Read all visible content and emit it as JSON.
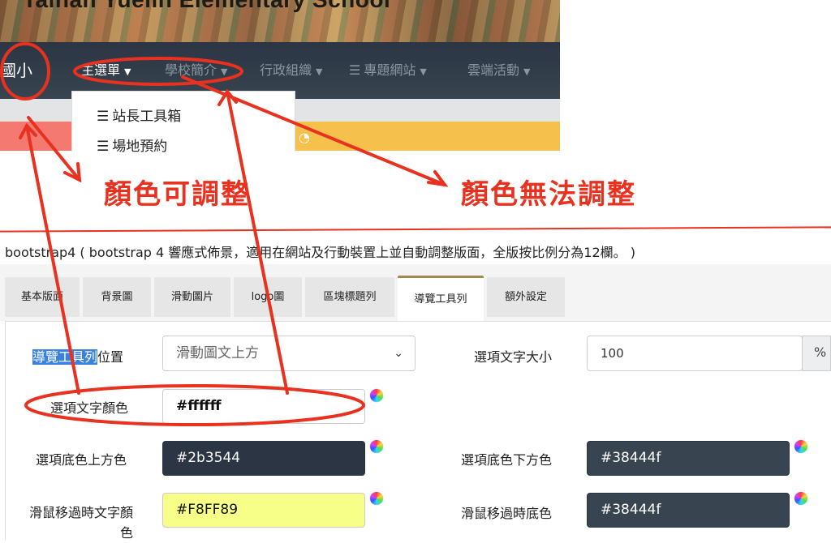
{
  "banner": {
    "title": "Tainan Yuelin Elementary School"
  },
  "navbar": {
    "brand": "國小",
    "items": [
      {
        "label": "主選單"
      },
      {
        "label": "學校簡介"
      },
      {
        "label": "行政組織"
      },
      {
        "label": "專題網站"
      },
      {
        "label": "雲端活動"
      }
    ],
    "bg_top": "#2b3544",
    "bg_bottom": "#38444f",
    "item_color": "#8b96a3"
  },
  "dropdown": {
    "items": [
      {
        "label": "站長工具箱",
        "icon": "list-icon"
      },
      {
        "label": "場地預約",
        "icon": "list-icon"
      }
    ]
  },
  "annotations": {
    "adjustable": "顏色可調整",
    "not_adjustable": "顏色無法調整",
    "color": "#e8311f"
  },
  "settings": {
    "description": "bootstrap4 ( bootstrap 4 響應式佈景，適用在網站及行動裝置上並自動調整版面，全版按比例分為12欄。 )",
    "tabs": [
      {
        "label": "基本版面"
      },
      {
        "label": "背景圖"
      },
      {
        "label": "滑動圖片"
      },
      {
        "label": "logo圖"
      },
      {
        "label": "區塊標題列"
      },
      {
        "label": "導覽工具列",
        "active": true
      },
      {
        "label": "額外設定"
      }
    ],
    "fields": {
      "position": {
        "label_highlight": "導覽工具列",
        "label_rest": "位置",
        "value": "滑動圖文上方"
      },
      "font_size": {
        "label": "選項文字大小",
        "value": "100",
        "unit": "%"
      },
      "font_color": {
        "label": "選項文字顏色",
        "value": "#ffffff"
      },
      "bg_top": {
        "label": "選項底色上方色",
        "value": "#2b3544"
      },
      "bg_bottom": {
        "label": "選項底色下方色",
        "value": "#38444f"
      },
      "hover_text": {
        "label_line1": "滑鼠移過時文字顏",
        "label_line2": "色",
        "value": "#F8FF89"
      },
      "hover_bg": {
        "label": "滑鼠移過時底色",
        "value": "#38444f"
      }
    }
  }
}
